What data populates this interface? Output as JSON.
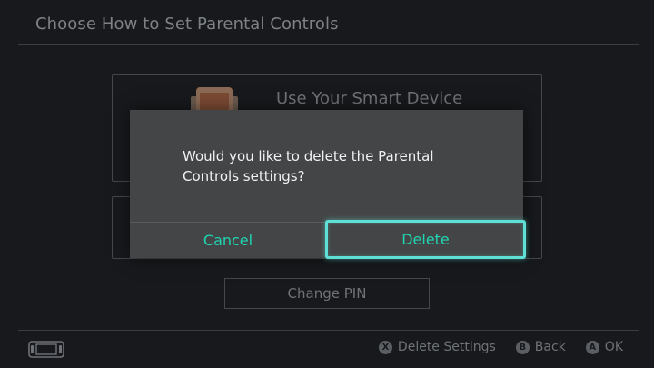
{
  "header": {
    "title": "Choose How to Set Parental Controls"
  },
  "options": {
    "smart_device_label": "Use Your Smart Device",
    "change_pin_label": "Change PIN"
  },
  "dialog": {
    "message": "Would you like to delete the Parental Controls settings?",
    "cancel_label": "Cancel",
    "delete_label": "Delete"
  },
  "footer": {
    "hints": [
      {
        "glyph": "X",
        "label": "Delete Settings"
      },
      {
        "glyph": "B",
        "label": "Back"
      },
      {
        "glyph": "A",
        "label": "OK"
      }
    ]
  },
  "colors": {
    "accent": "#1fd6b3",
    "focus_border": "#5fe0d6",
    "dialog_bg": "#444546",
    "screen_bg": "#17191c"
  },
  "icons": {
    "smart_device": "smartphone-icon",
    "console": "handheld-console-icon"
  }
}
